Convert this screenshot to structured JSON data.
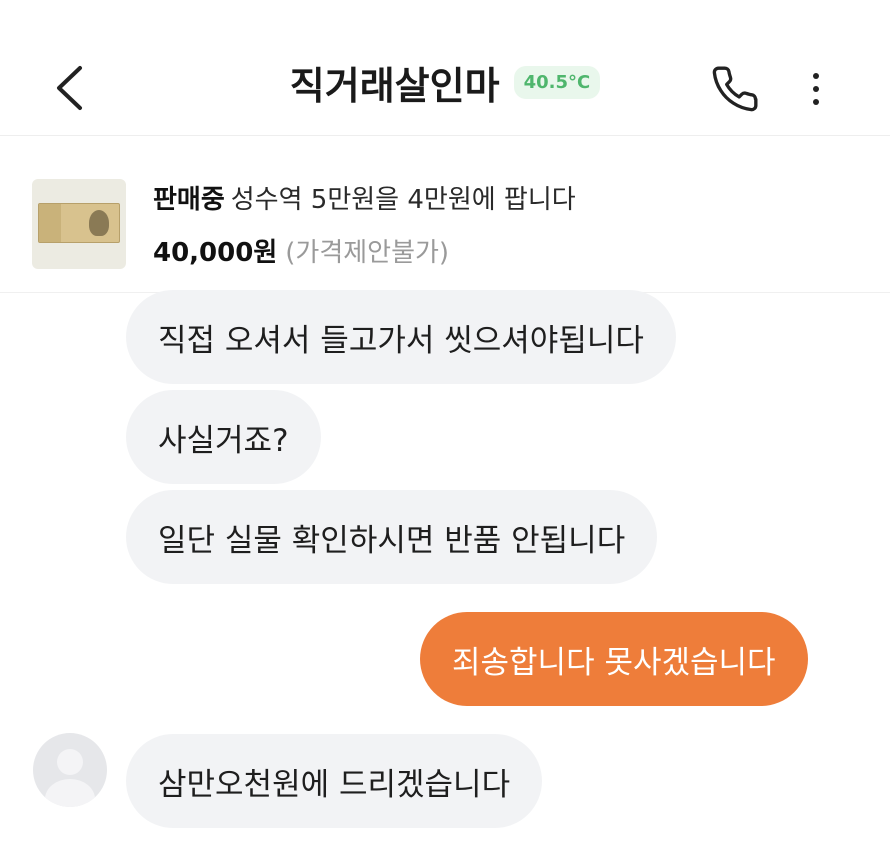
{
  "header": {
    "title": "직거래살인마",
    "temperature": "40.5°C",
    "icons": [
      "chevron-left-icon",
      "phone-icon",
      "more-vertical-icon"
    ],
    "accent_color": "#4fb66d"
  },
  "product": {
    "status": "판매중",
    "title": "성수역 5만원을 4만원에 팝니다",
    "price": "40,000원",
    "negotiation": "(가격제안불가)",
    "thumbnail": "banknote-image"
  },
  "messages": [
    {
      "direction": "incoming",
      "text": "직접 오셔서 들고가서 씻으셔야됩니다"
    },
    {
      "direction": "incoming",
      "text": "사실거죠?"
    },
    {
      "direction": "incoming",
      "text": "일단 실물 확인하시면 반품 안됩니다"
    },
    {
      "direction": "outgoing",
      "text": "죄송합니다 못사겠습니다"
    },
    {
      "direction": "incoming",
      "text": "삼만오천원에 드리겠습니다",
      "with_avatar": true
    }
  ],
  "colors": {
    "outgoing_bubble": "#ee7d3a",
    "incoming_bubble": "#f2f3f5"
  }
}
